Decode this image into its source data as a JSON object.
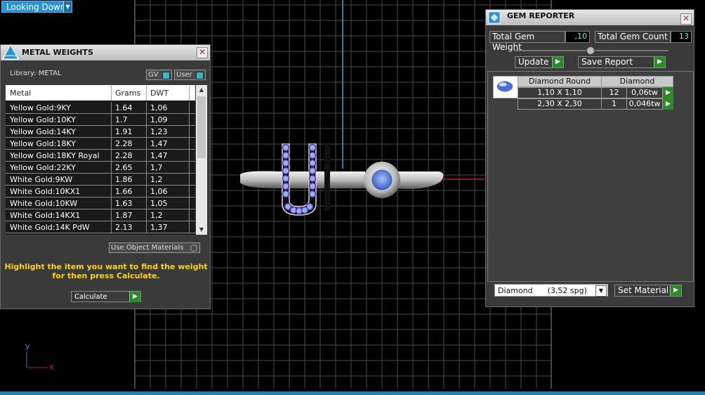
{
  "viewport": {
    "view_selector": "Looking Down",
    "axis_y": "y",
    "axis_x": "x",
    "colors": {
      "background": "#000000",
      "grid": "#555555",
      "axis_green": "#1fb5c9",
      "axis_red": "#c21c1c",
      "accent_blue": "#2a93d5"
    }
  },
  "metal_weights": {
    "title": "METAL WEIGHTS",
    "library_label": "Library: METAL",
    "toggle_gv": "GV",
    "toggle_user": "User",
    "columns": [
      "Metal",
      "Grams",
      "DWT"
    ],
    "rows": [
      {
        "metal": "Yellow Gold:9KY",
        "grams": "1.64",
        "dwt": "1,06"
      },
      {
        "metal": "Yellow Gold:10KY",
        "grams": "1.7",
        "dwt": "1,09"
      },
      {
        "metal": "Yellow Gold:14KY",
        "grams": "1.91",
        "dwt": "1,23"
      },
      {
        "metal": "Yellow Gold:18KY",
        "grams": "2.28",
        "dwt": "1,47"
      },
      {
        "metal": "Yellow Gold:18KY Royal",
        "grams": "2.28",
        "dwt": "1,47"
      },
      {
        "metal": "Yellow Gold:22KY",
        "grams": "2.65",
        "dwt": "1,7"
      },
      {
        "metal": "White Gold:9KW",
        "grams": "1.86",
        "dwt": "1,2"
      },
      {
        "metal": "White Gold:10KX1",
        "grams": "1.66",
        "dwt": "1,06"
      },
      {
        "metal": "White Gold:10KW",
        "grams": "1.63",
        "dwt": "1,05"
      },
      {
        "metal": "White Gold:14KX1",
        "grams": "1.87",
        "dwt": "1,2"
      },
      {
        "metal": "White Gold:14K PdW",
        "grams": "2.13",
        "dwt": "1,37"
      }
    ],
    "use_object_materials": "Use Object Materials",
    "hint_line1": "Highlight the item you want to find the weight",
    "hint_line2": "for then press Calculate.",
    "calculate_label": "Calculate"
  },
  "gem_reporter": {
    "title": "GEM REPORTER",
    "total_weight_label": "Total Gem Weight",
    "total_weight_value": ",10",
    "total_count_label": "Total Gem Count",
    "total_count_value": "13",
    "update_label": "Update",
    "save_report_label": "Save Report",
    "header_shape": "Diamond Round",
    "header_material": "Diamond",
    "gems": [
      {
        "size": "1,10 X 1,10",
        "count": "12",
        "weight": "0,06tw"
      },
      {
        "size": "2,30 X 2,30",
        "count": "1",
        "weight": "0,046tw"
      }
    ],
    "material_select": "Diamond      (3,52 spg)",
    "set_material_label": "Set Material"
  }
}
